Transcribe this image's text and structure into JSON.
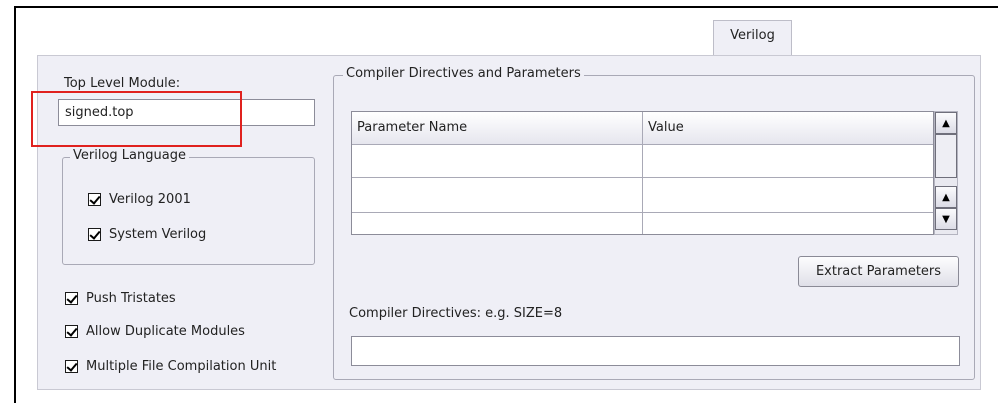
{
  "tab": {
    "label": "Verilog"
  },
  "top_level_module": {
    "label": "Top Level Module:",
    "value": "signed.top"
  },
  "verilog_language": {
    "legend": "Verilog Language",
    "options": [
      {
        "label": "Verilog 2001",
        "checked": true
      },
      {
        "label": "System Verilog",
        "checked": true
      }
    ]
  },
  "options": [
    {
      "label": "Push Tristates",
      "checked": true
    },
    {
      "label": "Allow Duplicate Modules",
      "checked": true
    },
    {
      "label": "Multiple File Compilation Unit",
      "checked": true
    }
  ],
  "compiler": {
    "legend": "Compiler Directives and Parameters",
    "table": {
      "columns": [
        "Parameter Name",
        "Value"
      ],
      "rows": [
        [
          "",
          ""
        ],
        [
          "",
          ""
        ],
        [
          "",
          ""
        ]
      ]
    },
    "extract_button": "Extract Parameters",
    "directives_label": "Compiler Directives: e.g. SIZE=8",
    "directives_value": ""
  },
  "colors": {
    "highlight": "#e0211e",
    "panel_bg": "#efeff6"
  },
  "icons": [
    "scroll-up-icon",
    "scroll-down-icon",
    "checkmark-icon"
  ]
}
